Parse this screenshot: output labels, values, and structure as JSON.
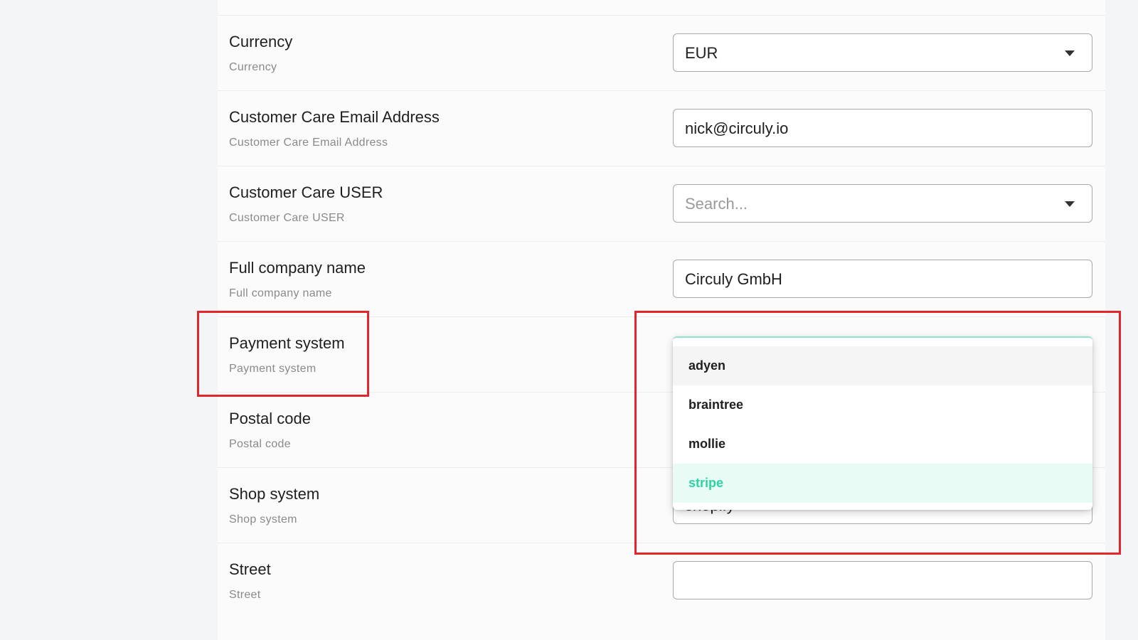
{
  "form": {
    "rows": [
      {
        "label": "Currency",
        "sublabel": "Currency",
        "value": "EUR",
        "control": "select"
      },
      {
        "label": "Customer Care Email Address",
        "sublabel": "Customer Care Email Address",
        "value": "nick@circuly.io",
        "control": "input"
      },
      {
        "label": "Customer Care USER",
        "sublabel": "Customer Care USER",
        "value": "",
        "placeholder": "Search...",
        "control": "select"
      },
      {
        "label": "Full company name",
        "sublabel": "Full company name",
        "value": "Circuly GmbH",
        "control": "input"
      },
      {
        "label": "Payment system",
        "sublabel": "Payment system",
        "value": "stripe",
        "control": "select-open"
      },
      {
        "label": "Postal code",
        "sublabel": "Postal code",
        "value": "",
        "control": "input"
      },
      {
        "label": "Shop system",
        "sublabel": "Shop system",
        "value": "shopify",
        "control": "select"
      },
      {
        "label": "Street",
        "sublabel": "Street",
        "value": "",
        "control": "input"
      }
    ]
  },
  "payment_dropdown": {
    "options": [
      "adyen",
      "braintree",
      "mollie",
      "stripe"
    ],
    "hovered": "adyen",
    "selected": "stripe"
  },
  "icons": {
    "select_caret": "chevron-down-icon"
  },
  "colors": {
    "accent": "#2fd3a3",
    "selected_bg": "#e8fbf5",
    "highlight_box": "#e3262c",
    "border": "#a9a9a9"
  }
}
